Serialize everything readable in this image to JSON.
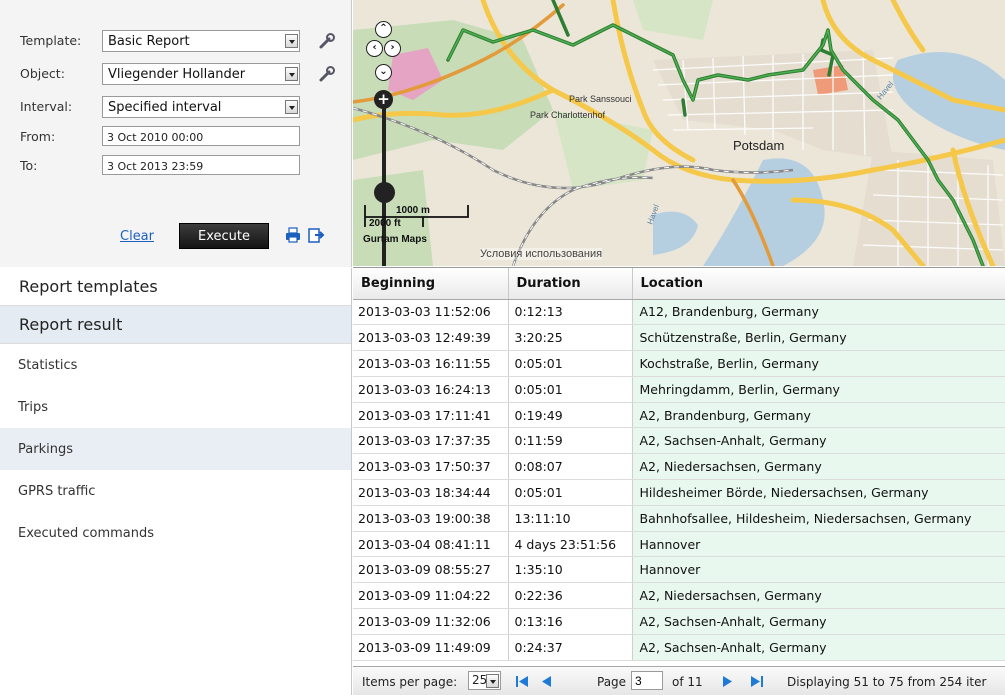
{
  "form": {
    "template_label": "Template:",
    "template_value": "Basic Report",
    "object_label": "Object:",
    "object_value": "Vliegender Hollander",
    "interval_label": "Interval:",
    "interval_value": "Specified interval",
    "from_label": "From:",
    "from_value": "3 Oct 2010 00:00",
    "to_label": "To:",
    "to_value": "3 Oct 2013 23:59",
    "clear_label": "Clear",
    "execute_label": "Execute",
    "icons": [
      "wrench-icon",
      "wrench-icon",
      "print-icon",
      "export-icon"
    ]
  },
  "nav": {
    "report_templates": "Report templates",
    "report_result": "Report result",
    "items": [
      "Statistics",
      "Trips",
      "Parkings",
      "GPRS traffic",
      "Executed commands"
    ],
    "active_item": "Parkings"
  },
  "map": {
    "labels": {
      "park_sanssouci": "Park Sanssouci",
      "park_charlottenhof": "Park Charlottenhof",
      "potsdam": "Potsdam",
      "havel": "Havel",
      "havel2": "Havel",
      "scale_m": "1000 m",
      "scale_ft": "2000 ft",
      "brand": "Gurtam Maps",
      "terms": "Условия использования"
    },
    "colors": {
      "track": "#2e7d32",
      "major_road": "#f5c84a",
      "park": "#c8dcb8",
      "water": "#b5cfe0"
    }
  },
  "table": {
    "columns": [
      "Beginning",
      "Duration",
      "Location"
    ],
    "rows": [
      [
        "2013-03-03 11:52:06",
        "0:12:13",
        "A12, Brandenburg, Germany"
      ],
      [
        "2013-03-03 12:49:39",
        "3:20:25",
        "Schützenstraße, Berlin, Germany"
      ],
      [
        "2013-03-03 16:11:55",
        "0:05:01",
        "Kochstraße, Berlin, Germany"
      ],
      [
        "2013-03-03 16:24:13",
        "0:05:01",
        "Mehringdamm, Berlin, Germany"
      ],
      [
        "2013-03-03 17:11:41",
        "0:19:49",
        "A2, Brandenburg, Germany"
      ],
      [
        "2013-03-03 17:37:35",
        "0:11:59",
        "A2, Sachsen-Anhalt, Germany"
      ],
      [
        "2013-03-03 17:50:37",
        "0:08:07",
        "A2, Niedersachsen, Germany"
      ],
      [
        "2013-03-03 18:34:44",
        "0:05:01",
        "Hildesheimer Börde, Niedersachsen, Germany"
      ],
      [
        "2013-03-03 19:00:38",
        "13:11:10",
        "Bahnhofsallee, Hildesheim, Niedersachsen, Germany"
      ],
      [
        "2013-03-04 08:41:11",
        "4 days 23:51:56",
        "Hannover"
      ],
      [
        "2013-03-09 08:55:27",
        "1:35:10",
        "Hannover"
      ],
      [
        "2013-03-09 11:04:22",
        "0:22:36",
        "A2, Niedersachsen, Germany"
      ],
      [
        "2013-03-09 11:32:06",
        "0:13:16",
        "A2, Sachsen-Anhalt, Germany"
      ],
      [
        "2013-03-09 11:49:09",
        "0:24:37",
        "A2, Sachsen-Anhalt, Germany"
      ]
    ]
  },
  "pager": {
    "items_per_page_label": "Items per page:",
    "items_per_page_value": "25",
    "page_label": "Page",
    "page_value": "3",
    "of_label": "of 11",
    "displaying": "Displaying 51 to 75 from 254 iter"
  }
}
